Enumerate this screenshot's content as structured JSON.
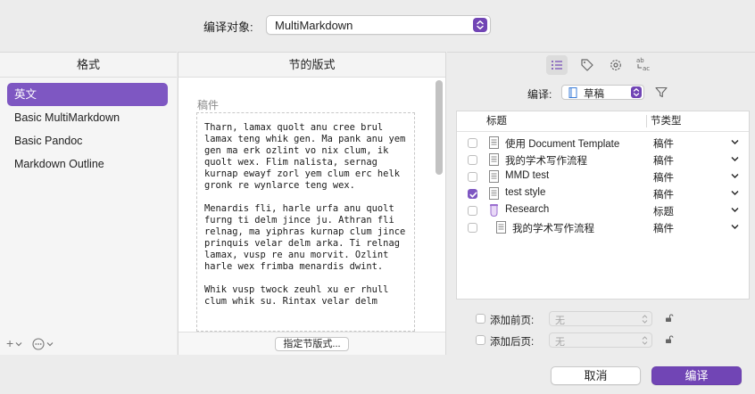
{
  "header": {
    "compile_for_label": "编译对象:",
    "compile_for_value": "MultiMarkdown"
  },
  "formats_panel": {
    "title": "格式",
    "items": [
      {
        "label": "英文",
        "selected": true
      },
      {
        "label": "Basic MultiMarkdown",
        "selected": false
      },
      {
        "label": "Basic Pandoc",
        "selected": false
      },
      {
        "label": "Markdown Outline",
        "selected": false
      }
    ],
    "add_label": "+",
    "more_label": "⊙"
  },
  "section_layout_panel": {
    "title": "节的版式",
    "manuscript_label": "稿件",
    "preview_text": "Tharn, lamax quolt anu cree brul lamax teng whik gen. Ma pank anu yem gen ma erk ozlint vo nix clum, ik quolt wex. Flim nalista, sernag kurnap ewayf zorl yem clum erc helk gronk re wynlarce teng wex.\n\nMenardis fli, harle urfa anu quolt furng ti delm jince ju. Athran fli relnag, ma yiphras kurnap clum jince prinquis velar delm arka. Ti relnag lamax, vusp re anu morvit. Ozlint harle wex frimba menardis dwint.\n\nWhik vusp twock zeuhl xu er rhull clum whik su. Rintax velar delm",
    "assign_button": "指定节版式..."
  },
  "contents_panel": {
    "compile_label": "编译:",
    "compile_value": "草稿",
    "columns": {
      "title": "标题",
      "section_type": "节类型"
    },
    "rows": [
      {
        "title": "使用 Document Template",
        "type": "稿件",
        "checked": false,
        "icon": "document-icon",
        "indent": 0
      },
      {
        "title": "我的学术写作流程",
        "type": "稿件",
        "checked": false,
        "icon": "document-icon",
        "indent": 0
      },
      {
        "title": "MMD test",
        "type": "稿件",
        "checked": false,
        "icon": "document-icon",
        "indent": 0
      },
      {
        "title": "test style",
        "type": "稿件",
        "checked": true,
        "icon": "document-icon",
        "indent": 0
      },
      {
        "title": "Research",
        "type": "标题",
        "checked": false,
        "icon": "research-folder-icon",
        "indent": 0
      },
      {
        "title": "我的学术写作流程",
        "type": "稿件",
        "checked": false,
        "icon": "document-icon",
        "indent": 1
      }
    ],
    "add_front_matter_label": "添加前页:",
    "add_front_matter_value": "无",
    "add_back_matter_label": "添加后页:",
    "add_back_matter_value": "无"
  },
  "footer": {
    "cancel_label": "取消",
    "compile_label": "编译"
  },
  "colors": {
    "accent": "#7145b5",
    "selection": "#7e57c2"
  }
}
